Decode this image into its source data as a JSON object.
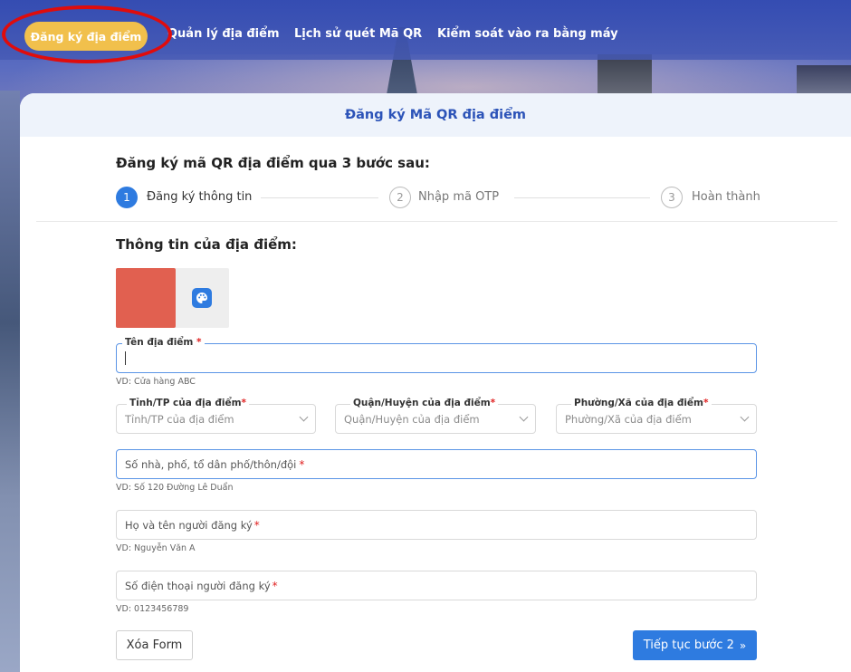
{
  "nav": {
    "items": [
      {
        "label": "Đăng ký địa điểm",
        "active": true
      },
      {
        "label": "Quản lý địa điểm"
      },
      {
        "label": "Lịch sử quét Mã QR"
      },
      {
        "label": "Kiểm soát vào ra bằng máy"
      }
    ]
  },
  "card": {
    "header": "Đăng ký Mã QR địa điểm",
    "steps_title": "Đăng ký mã QR địa điểm qua 3 bước sau:",
    "steps": [
      {
        "number": "1",
        "label": "Đăng ký thông tin",
        "active": true
      },
      {
        "number": "2",
        "label": "Nhập mã OTP"
      },
      {
        "number": "3",
        "label": "Hoàn thành"
      }
    ],
    "section_title": "Thông tin của địa điểm:"
  },
  "form": {
    "name": {
      "label": "Tên địa điểm",
      "value": "",
      "hint": "VD: Cửa hàng ABC"
    },
    "province": {
      "label": "Tỉnh/TP của địa điểm",
      "placeholder": "Tỉnh/TP của địa điểm"
    },
    "district": {
      "label": "Quận/Huyện của địa điểm",
      "placeholder": "Quận/Huyện của địa điểm"
    },
    "ward": {
      "label": "Phường/Xã của địa điểm",
      "placeholder": "Phường/Xã của địa điểm"
    },
    "address": {
      "placeholder": "Số nhà, phố, tổ dân phố/thôn/đội",
      "hint": "VD: Số 120 Đường Lê Duẩn"
    },
    "fullname": {
      "placeholder": "Họ và tên người đăng ký",
      "hint": "VD: Nguyễn Văn A"
    },
    "phone": {
      "placeholder": "Số điện thoại người đăng ký",
      "hint": "VD: 0123456789"
    },
    "required_mark": "*"
  },
  "buttons": {
    "clear": "Xóa Form",
    "next": "Tiếp tục bước 2",
    "next_icon": "»"
  },
  "colors": {
    "accent": "#2e7be0",
    "nav_active": "#f1c04c",
    "selected_color": "#e16050",
    "required": "#e02020"
  }
}
